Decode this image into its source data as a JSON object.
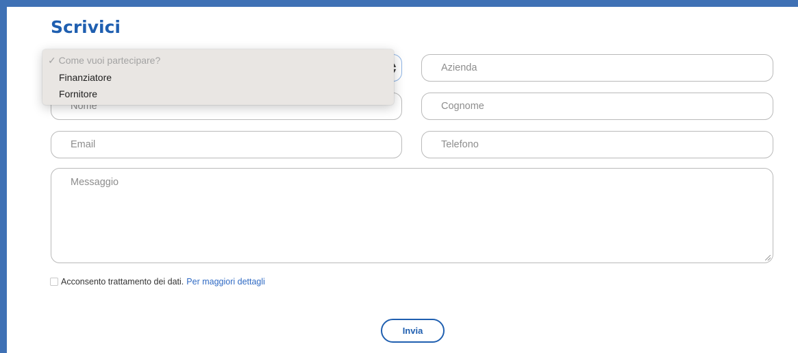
{
  "form": {
    "title": "Scrivici",
    "participation_select": {
      "placeholder": "Come vuoi partecipare?",
      "options": [
        "Finanziatore",
        "Fornitore"
      ],
      "open": true
    },
    "fields": {
      "nome": "Nome",
      "email": "Email",
      "azienda": "Azienda",
      "cognome": "Cognome",
      "telefono": "Telefono",
      "messaggio": "Messaggio"
    },
    "consent_text": "Acconsento trattamento dei dati.",
    "consent_link": "Per maggiori dettagli",
    "submit_label": "Invia"
  },
  "dropdown": {
    "check_mark": "✓",
    "placeholder_label": "Come vuoi partecipare?"
  },
  "colors": {
    "frame": "#3f71b5",
    "accent": "#1f5fb0",
    "link": "#2f6ac4"
  }
}
